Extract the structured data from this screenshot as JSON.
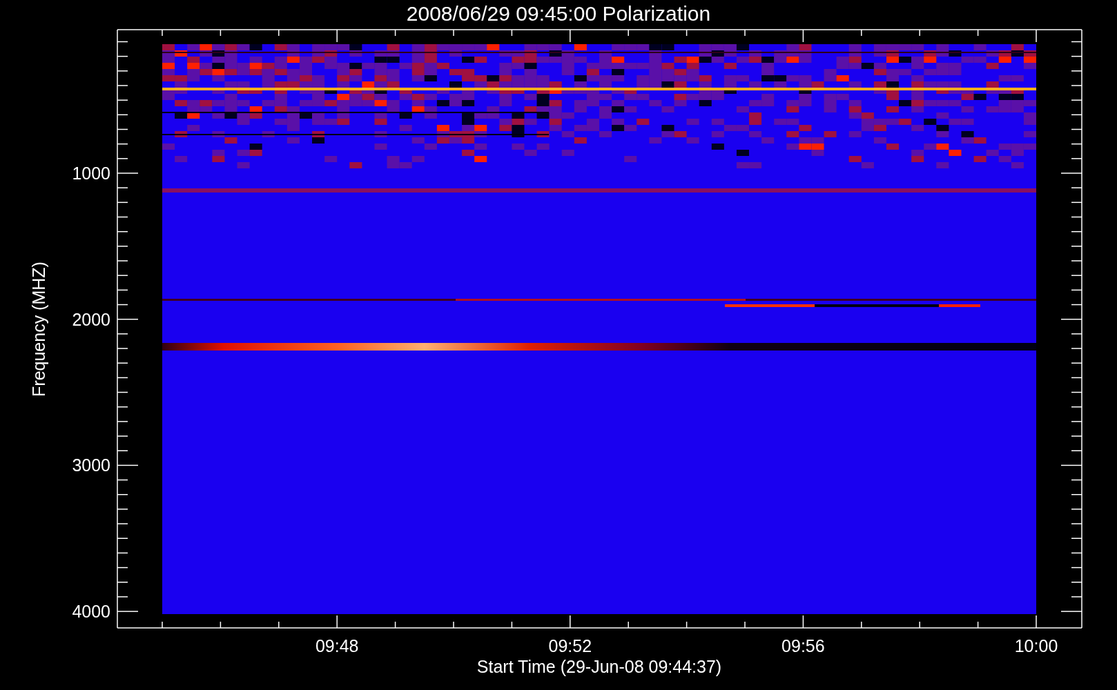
{
  "title": "2008/06/29 09:45:00 Polarization",
  "y_axis": {
    "label": "Frequency (MHZ)",
    "tick_labels": [
      "1000",
      "2000",
      "3000",
      "4000"
    ]
  },
  "x_axis": {
    "label": "Start Time (29-Jun-08 09:44:37)",
    "tick_labels": [
      "09:48",
      "09:52",
      "09:56",
      "10:00"
    ]
  }
}
